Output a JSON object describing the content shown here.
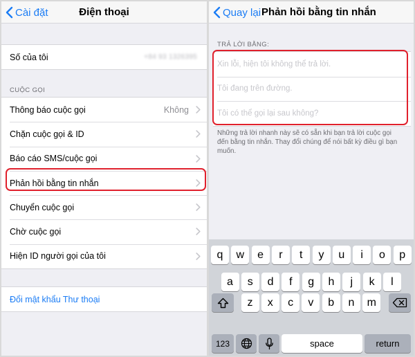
{
  "left": {
    "nav": {
      "back_label": "Cài đặt",
      "title": "Điện thoại"
    },
    "my_number": {
      "label": "Số của tôi",
      "value": "+84 93 1326395"
    },
    "calls_section_header": "CUỘC GỌI",
    "call_items": [
      {
        "label": "Thông báo cuộc gọi",
        "value": "Không"
      },
      {
        "label": "Chặn cuộc gọi & ID",
        "value": ""
      },
      {
        "label": "Báo cáo SMS/cuộc gọi",
        "value": ""
      },
      {
        "label": "Phản hồi bằng tin nhắn",
        "value": ""
      },
      {
        "label": "Chuyển cuộc gọi",
        "value": ""
      },
      {
        "label": "Chờ cuộc gọi",
        "value": ""
      },
      {
        "label": "Hiện ID người gọi của tôi",
        "value": ""
      }
    ],
    "voicemail_link": "Đổi mật khẩu Thư thoại"
  },
  "right": {
    "nav": {
      "back_label": "Quay lại",
      "title": "Phản hồi bằng tin nhắn"
    },
    "section_header": "TRẢ LỜI BẰNG:",
    "replies": [
      "Xin lỗi, hiện tôi không thể trả lời.",
      "Tôi đang trên đường.",
      "Tôi có thể gọi lại sau không?"
    ],
    "footer_note": "Những trả lời nhanh này sẽ có sẵn khi bạn trả lời cuộc gọi đến bằng tin nhắn. Thay đổi chúng để nói bất kỳ điều gì bạn muốn."
  },
  "keyboard": {
    "row1": [
      "q",
      "w",
      "e",
      "r",
      "t",
      "y",
      "u",
      "i",
      "o",
      "p"
    ],
    "row2": [
      "a",
      "s",
      "d",
      "f",
      "g",
      "h",
      "j",
      "k",
      "l"
    ],
    "row3": [
      "z",
      "x",
      "c",
      "v",
      "b",
      "n",
      "m"
    ],
    "numbers_label": "123",
    "space_label": "space",
    "return_label": "return",
    "icons": {
      "shift": "shift-icon",
      "delete": "delete-icon",
      "globe": "globe-icon",
      "mic": "microphone-icon"
    }
  },
  "colors": {
    "accent": "#1a7cf5",
    "highlight": "#e0202c",
    "keyboard_bg": "#d1d4d9"
  }
}
